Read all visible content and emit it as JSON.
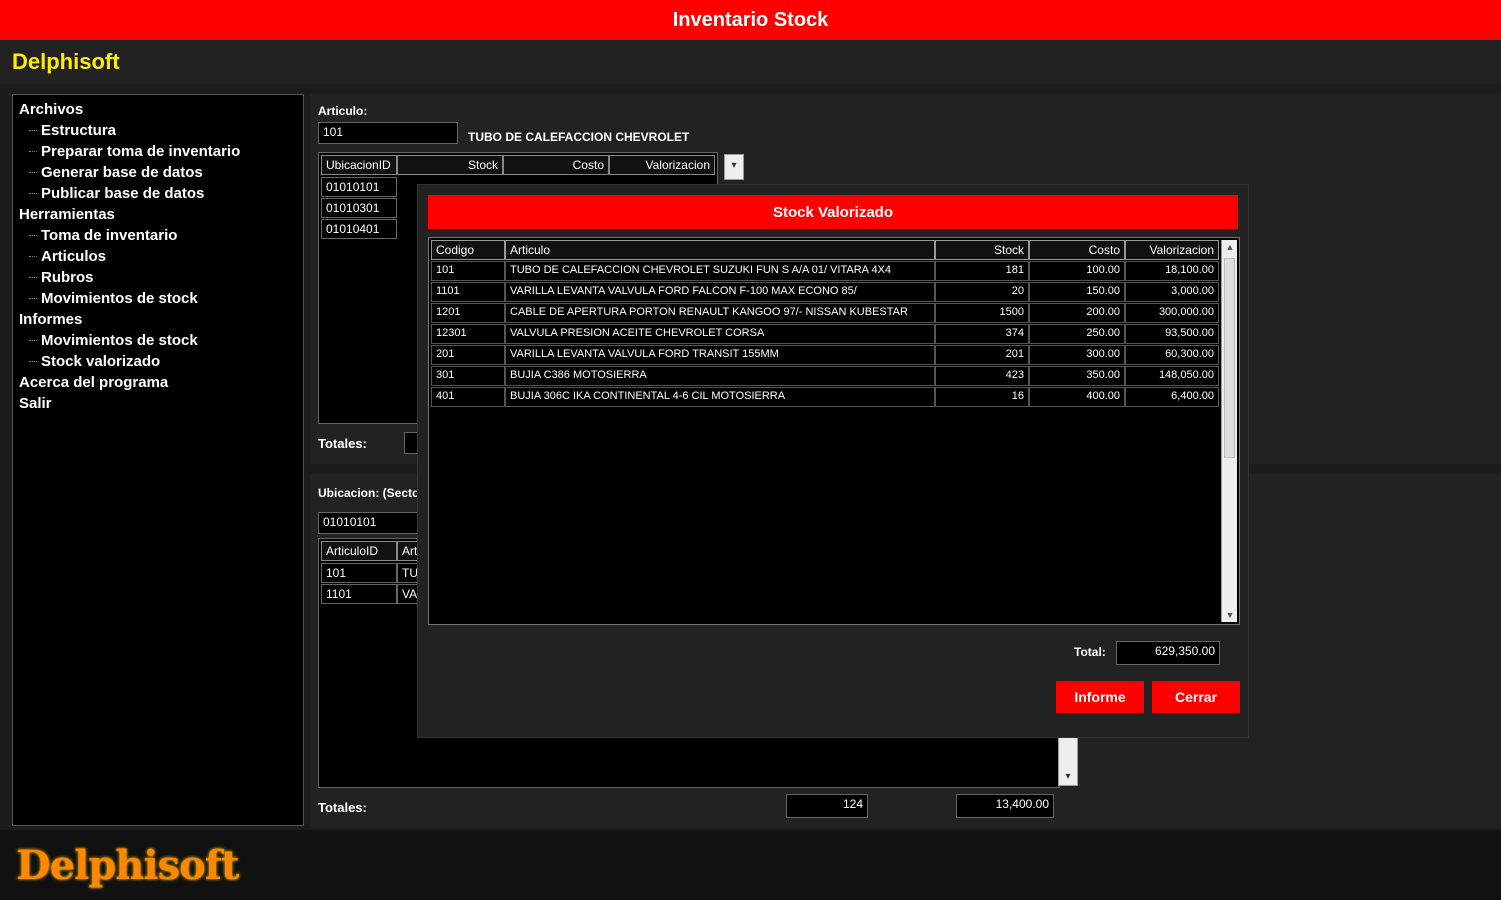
{
  "window": {
    "title": "Inventario Stock"
  },
  "brand": {
    "name": "Delphisoft",
    "footer_logo": "Delphisoft"
  },
  "tree": [
    {
      "label": "Archivos",
      "level": 0
    },
    {
      "label": "Estructura",
      "level": 1
    },
    {
      "label": "Preparar toma de inventario",
      "level": 1
    },
    {
      "label": "Generar base de datos",
      "level": 1
    },
    {
      "label": "Publicar base de datos",
      "level": 1
    },
    {
      "label": "Herramientas",
      "level": 0
    },
    {
      "label": "Toma de inventario",
      "level": 1
    },
    {
      "label": "Articulos",
      "level": 1
    },
    {
      "label": "Rubros",
      "level": 1
    },
    {
      "label": "Movimientos de stock",
      "level": 1
    },
    {
      "label": "Informes",
      "level": 0
    },
    {
      "label": "Movimientos de stock",
      "level": 1
    },
    {
      "label": "Stock valorizado",
      "level": 1
    },
    {
      "label": "Acerca del programa",
      "level": 0
    },
    {
      "label": "Salir",
      "level": 0
    }
  ],
  "articulo_panel": {
    "label": "Articulo:",
    "code": "101",
    "description": "TUBO DE CALEFACCION CHEVROLET",
    "headers": [
      "UbicacionID",
      "Stock",
      "Costo",
      "Valorizacion"
    ],
    "rows": [
      "01010101",
      "01010301",
      "01010401"
    ],
    "totales_label": "Totales:"
  },
  "ubicacion_panel": {
    "label": "Ubicacion: (Secto",
    "code": "01010101",
    "headers": [
      "ArticuloID",
      "Art"
    ],
    "rows": [
      {
        "id": "101",
        "art": "TUB"
      },
      {
        "id": "1101",
        "art": "VAR"
      }
    ],
    "totales_label": "Totales:",
    "total_stock": "124",
    "total_valor": "13,400.00"
  },
  "dialog": {
    "title": "Stock Valorizado",
    "headers": [
      "Codigo",
      "Articulo",
      "Stock",
      "Costo",
      "Valorizacion"
    ],
    "rows": [
      {
        "codigo": "101",
        "articulo": "TUBO DE CALEFACCION CHEVROLET SUZUKI FUN S A/A 01/ VITARA 4X4",
        "stock": "181",
        "costo": "100.00",
        "valor": "18,100.00"
      },
      {
        "codigo": "1101",
        "articulo": "VARILLA LEVANTA VALVULA FORD FALCON F-100 MAX ECONO 85/",
        "stock": "20",
        "costo": "150.00",
        "valor": "3,000.00"
      },
      {
        "codigo": "1201",
        "articulo": "CABLE DE APERTURA PORTON RENAULT KANGOO 97/- NISSAN KUBESTAR",
        "stock": "1500",
        "costo": "200.00",
        "valor": "300,000.00"
      },
      {
        "codigo": "12301",
        "articulo": "VALVULA PRESION ACEITE CHEVROLET CORSA",
        "stock": "374",
        "costo": "250.00",
        "valor": "93,500.00"
      },
      {
        "codigo": "201",
        "articulo": "VARILLA LEVANTA VALVULA FORD TRANSIT 155MM",
        "stock": "201",
        "costo": "300.00",
        "valor": "60,300.00"
      },
      {
        "codigo": "301",
        "articulo": "BUJIA C386 MOTOSIERRA",
        "stock": "423",
        "costo": "350.00",
        "valor": "148,050.00"
      },
      {
        "codigo": "401",
        "articulo": "BUJIA 306C IKA CONTINENTAL 4-6 CIL MOTOSIERRA",
        "stock": "16",
        "costo": "400.00",
        "valor": "6,400.00"
      }
    ],
    "total_label": "Total:",
    "total_value": "629,350.00",
    "btn_informe": "Informe",
    "btn_cerrar": "Cerrar"
  },
  "colors": {
    "accent": "#ff0000",
    "brand": "#ffee00",
    "logo": "#ff8800"
  }
}
